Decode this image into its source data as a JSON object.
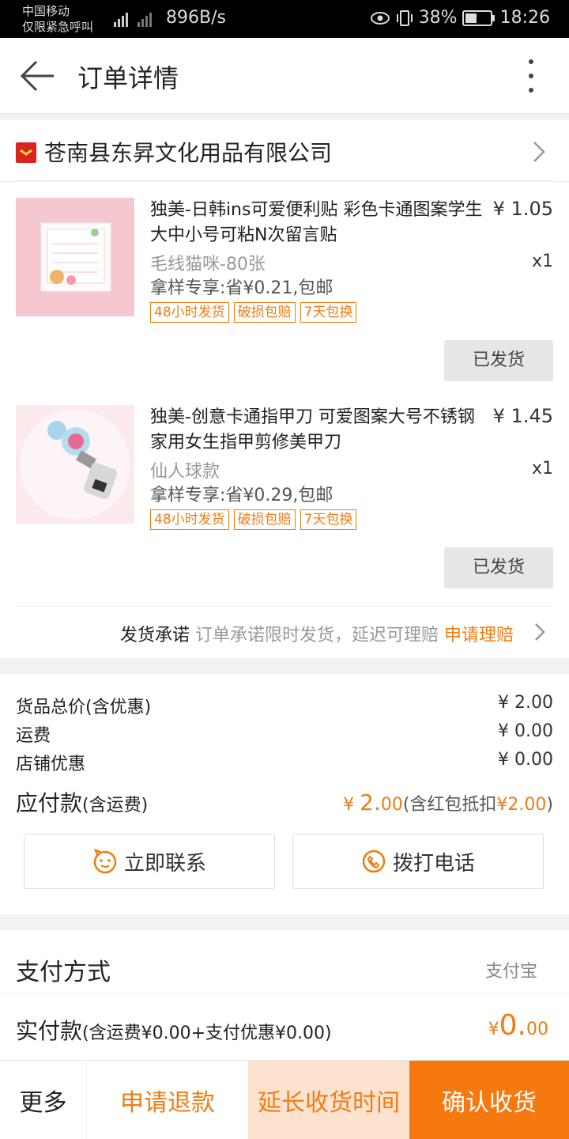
{
  "status_bar": {
    "carrier_line1": "中国移动",
    "carrier_line2": "仅限紧急呼叫",
    "net_speed": "896B/s",
    "battery": "38%",
    "time": "18:26"
  },
  "header": {
    "title": "订单详情"
  },
  "shop": {
    "name": "苍南县东昇文化用品有限公司"
  },
  "items": [
    {
      "title": "独美-日韩ins可爱便利贴 彩色卡通图案学生大中小号可粘N次留言贴",
      "price": "¥ 1.05",
      "spec": "毛线猫咪-80张",
      "qty": "x1",
      "promo": "拿样专享:省¥0.21,包邮",
      "tags": [
        "48小时发货",
        "破损包赔",
        "7天包换"
      ],
      "status_button": "已发货"
    },
    {
      "title": "独美-创意卡通指甲刀 可爱图案大号不锈钢家用女生指甲剪修美甲刀",
      "price": "¥ 1.45",
      "spec": "仙人球款",
      "qty": "x1",
      "promo": "拿样专享:省¥0.29,包邮",
      "tags": [
        "48小时发货",
        "破损包赔",
        "7天包换"
      ],
      "status_button": "已发货"
    }
  ],
  "promise": {
    "label": "发货承诺",
    "text": "订单承诺限时发货，延迟可理赔",
    "link": "申请理赔"
  },
  "pricing": {
    "goods_total_label": "货品总价(含优惠)",
    "goods_total": "¥ 2.00",
    "shipping_label": "运费",
    "shipping": "¥ 0.00",
    "shop_discount_label": "店铺优惠",
    "shop_discount": "¥ 0.00",
    "payable_label": "应付款",
    "payable_sub": "(含运费)",
    "payable_currency": "¥ ",
    "payable_int": "2.",
    "payable_dec": "00",
    "payable_note_pre": "(含红包抵扣",
    "payable_note_amount": "¥2.00",
    "payable_note_post": ")"
  },
  "contact": {
    "contact_now": "立即联系",
    "call": "拨打电话"
  },
  "payment": {
    "method_label": "支付方式",
    "method_value": "支付宝",
    "paid_label": "实付款",
    "paid_sub": "(含运费¥0.00+支付优惠¥0.00)",
    "paid_currency": "¥",
    "paid_int": "0.",
    "paid_dec": "00"
  },
  "bottom_bar": {
    "more": "更多",
    "refund": "申请退款",
    "extend": "延长收货时间",
    "confirm": "确认收货"
  },
  "colors": {
    "accent": "#f07c13",
    "confirm_bg": "#f5790f",
    "extend_bg": "#fde3cf"
  }
}
